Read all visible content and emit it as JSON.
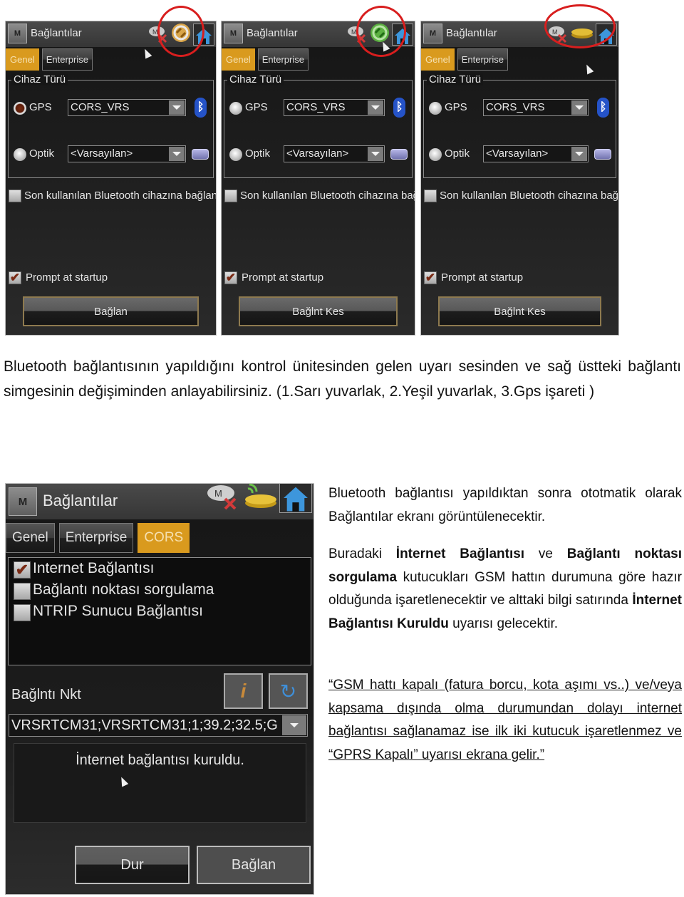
{
  "panels": [
    {
      "title": "Bağlantılar",
      "menu_label": "M",
      "tabs": [
        "Genel",
        "Enterprise"
      ],
      "active_tab": "Genel",
      "status_icon": "sync-yellow-circle",
      "group_label": "Cihaz Türü",
      "gps_label": "GPS",
      "gps_selected": true,
      "gps_value": "CORS_VRS",
      "optik_label": "Optik",
      "optik_value": "<Varsayılan>",
      "last_bt_label": "Son kullanılan Bluetooth cihazına bağlan",
      "prompt_label": "Prompt at startup",
      "prompt_checked": true,
      "action_label": "Bağlan"
    },
    {
      "title": "Bağlantılar",
      "menu_label": "M",
      "tabs": [
        "Genel",
        "Enterprise"
      ],
      "active_tab": "Genel",
      "status_icon": "sync-green-circle",
      "group_label": "Cihaz Türü",
      "gps_label": "GPS",
      "gps_selected": false,
      "gps_value": "CORS_VRS",
      "optik_label": "Optik",
      "optik_value": "<Varsayılan>",
      "last_bt_label": "Son kullanılan Bluetooth cihazına bağlan",
      "prompt_label": "Prompt at startup",
      "prompt_checked": true,
      "action_label": "Bağlnt Kes"
    },
    {
      "title": "Bağlantılar",
      "menu_label": "M",
      "tabs": [
        "Genel",
        "Enterprise"
      ],
      "active_tab": "Genel",
      "status_icon": "gps-receiver",
      "group_label": "Cihaz Türü",
      "gps_label": "GPS",
      "gps_selected": false,
      "gps_value": "CORS_VRS",
      "optik_label": "Optik",
      "optik_value": "<Varsayılan>",
      "last_bt_label": "Son kullanılan Bluetooth cihazına bağlan",
      "prompt_label": "Prompt at startup",
      "prompt_checked": true,
      "action_label": "Bağlnt Kes"
    }
  ],
  "paragraph1": "Bluetooth bağlantısının yapıldığını kontrol ünitesinden gelen uyarı sesinden ve sağ üstteki bağlantı simgesinin değişiminden anlayabilirsiniz. (1.Sarı yuvarlak, 2.Yeşil yuvarlak, 3.Gps işareti )",
  "big_panel": {
    "title": "Bağlantılar",
    "menu_label": "M",
    "tabs": [
      "Genel",
      "Enterprise",
      "CORS"
    ],
    "active_tab": "CORS",
    "checks": [
      {
        "label": "Internet Bağlantısı",
        "checked": true
      },
      {
        "label": "Bağlantı noktası sorgulama",
        "checked": false
      },
      {
        "label": "NTRIP Sunucu Bağlantısı",
        "checked": false
      }
    ],
    "mountpoint_label": "Bağlntı Nkt",
    "mountpoint_value": "VRSRTCM31;VRSRTCM31;1;39.2;32.5;G",
    "status_message": "İnternet bağlantısı kuruldu.",
    "stop_label": "Dur",
    "connect_label": "Bağlan"
  },
  "right_text": {
    "p1": "Bluetooth bağlantısı yapıldıktan sonra ototmatik olarak Bağlantılar ekranı görüntülenecektir.",
    "p2_parts": [
      {
        "t": "Buradaki ",
        "b": false
      },
      {
        "t": "İnternet Bağlantısı",
        "b": true
      },
      {
        "t": " ve ",
        "b": false
      },
      {
        "t": "Bağlantı noktası sorgulama",
        "b": true
      },
      {
        "t": " kutucukları GSM hattın durumuna göre hazır olduğunda işaretlenecektir ve alttaki bilgi satırında ",
        "b": false
      },
      {
        "t": "İnternet Bağlantısı Kuruldu",
        "b": true
      },
      {
        "t": " uyarısı gelecektir.",
        "b": false
      }
    ],
    "p3": "“GSM hattı kapalı (fatura borcu, kota aşımı vs..) ve/veya kapsama dışında olma durumundan dolayı internet bağlantısı sağlanamaz ise ilk iki kutucuk işaretlenmez ve “GPRS Kapalı” uyarısı ekrana gelir.”"
  },
  "colors": {
    "accent_tab": "#d99a1e",
    "highlight_ring": "#d81e1e",
    "bluetooth": "#2553c8"
  }
}
